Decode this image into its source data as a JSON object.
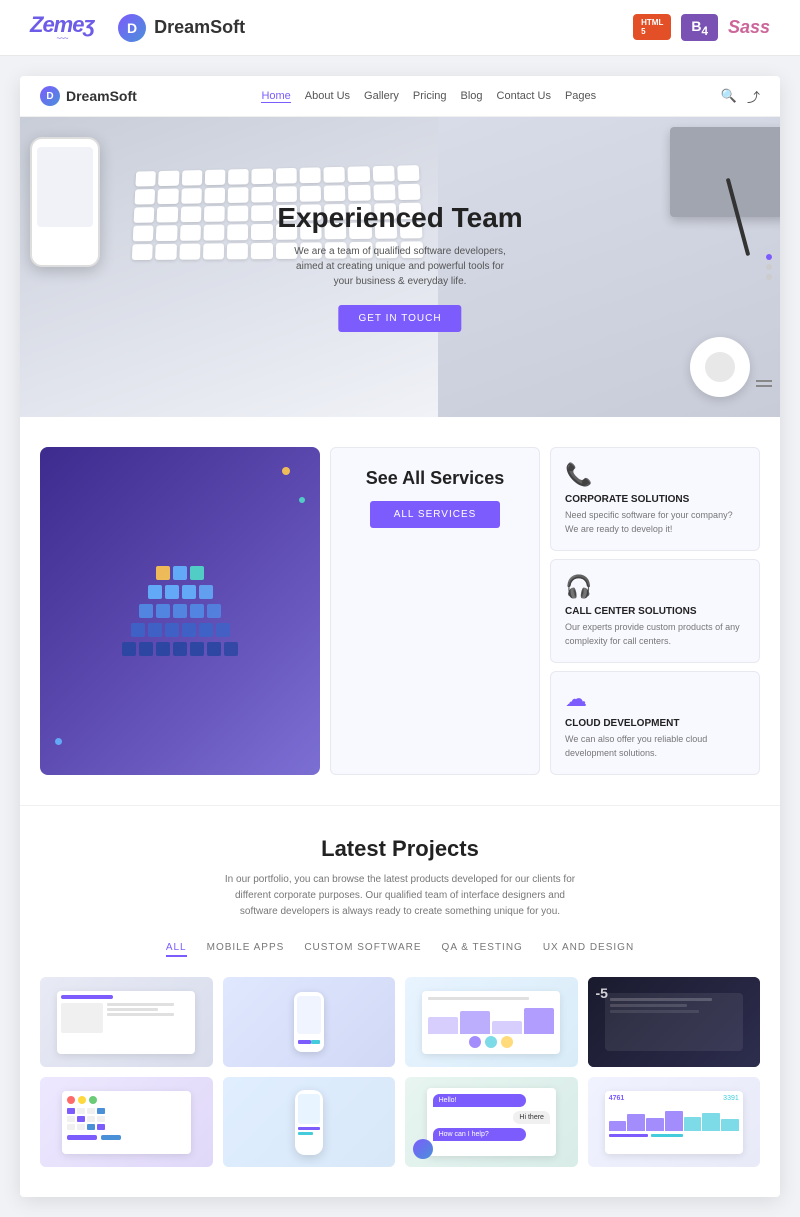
{
  "topbar": {
    "zemes_logo": "Zemeʒ",
    "dreamsoft_logo": "DreamSoft",
    "html_badge": "HTML",
    "html_version": "5",
    "bootstrap_badge": "B",
    "bootstrap_version": "4",
    "sass_badge": "Sass"
  },
  "nav": {
    "brand": "DreamSoft",
    "links": [
      "Home",
      "About Us",
      "Gallery",
      "Pricing",
      "Blog",
      "Contact Us",
      "Pages"
    ],
    "active_link": "Home"
  },
  "hero": {
    "title": "Experienced Team",
    "subtitle": "We are a team of qualified software developers, aimed at creating unique and powerful tools for your business & everyday life.",
    "cta_button": "GET IN TOUCH"
  },
  "services": {
    "see_all_title": "See All Services",
    "see_all_button": "ALL SERVICES",
    "cards": [
      {
        "icon": "📞",
        "title": "CORPORATE SOLUTIONS",
        "desc": "Need specific software for your company? We are ready to develop it!"
      },
      {
        "icon": "🎧",
        "title": "CALL CENTER SOLUTIONS",
        "desc": "Our experts provide custom products of any complexity for call centers."
      },
      {
        "icon": "☁",
        "title": "CLOUD DEVELOPMENT",
        "desc": "We can also offer you reliable cloud development solutions."
      }
    ]
  },
  "projects": {
    "title": "Latest Projects",
    "description": "In our portfolio, you can browse the latest products developed for our clients for different corporate purposes. Our qualified team of interface designers and software developers is always ready to create something unique for you.",
    "filters": [
      "ALL",
      "MOBILE APPS",
      "CUSTOM SOFTWARE",
      "QA & TESTING",
      "UX AND DESIGN"
    ],
    "active_filter": "ALL"
  }
}
